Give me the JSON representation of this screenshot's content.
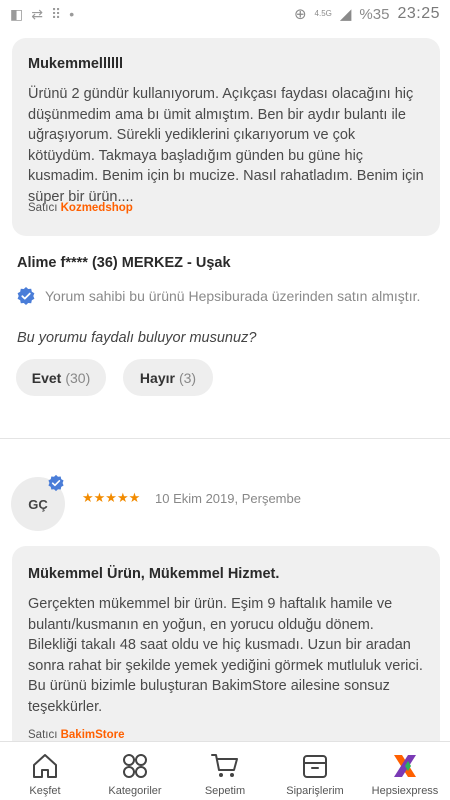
{
  "status_bar": {
    "time": "23:25",
    "battery": "%35",
    "network": "4.5G"
  },
  "review1": {
    "title": "Mukemmellllll",
    "body": "Ürünü 2 gündür kullanıyorum. Açıkçası faydası olacağını hiç düşünmedim ama bı ümit almıştım. Ben bir aydır bulantı ile uğraşıyorum. Sürekli yediklerini çıkarıyorum ve çok kötüydüm. Takmaya başladığım günden bu güne hiç kusmadim. Benim için bı mucize. Nasıl rahatladım. Benim için süper bir ürün....",
    "seller_label": "Satıcı",
    "seller_name": "Kozmedshop",
    "reviewer": "Alime f**** (36) MERKEZ - Uşak",
    "verified_text": "Yorum sahibi bu ürünü Hepsiburada üzerinden satın almıştır.",
    "helpful_question": "Bu yorumu faydalı buluyor musunuz?",
    "yes_label": "Evet",
    "yes_count": "(30)",
    "no_label": "Hayır",
    "no_count": "(3)"
  },
  "review2": {
    "avatar_initials": "GÇ",
    "rating": 5,
    "stars": "★★★★★",
    "date": "10 Ekim 2019, Perşembe",
    "title": "Mükemmel Ürün, Mükemmel Hizmet.",
    "body": "Gerçekten mükemmel bir ürün. Eşim 9 haftalık hamile ve bulantı/kusmanın en yoğun, en yorucu olduğu dönem. Bilekliği takalı 48 saat oldu ve hiç kusmadı. Uzun bir aradan sonra rahat bir şekilde yemek yediğini görmek mutluluk verici. Bu ürünü bizimle buluşturan BakimStore ailesine sonsuz teşekkürler.",
    "seller_label": "Satıcı",
    "seller_name": "BakimStore"
  },
  "nav": [
    {
      "label": "Keşfet",
      "icon": "home-icon"
    },
    {
      "label": "Kategoriler",
      "icon": "grid-icon"
    },
    {
      "label": "Sepetim",
      "icon": "cart-icon"
    },
    {
      "label": "Siparişlerim",
      "icon": "box-icon"
    },
    {
      "label": "Hepsiexpress",
      "icon": "hepsiexpress-logo"
    }
  ],
  "colors": {
    "accent": "#ff6000",
    "verified_blue": "#4a7dd8",
    "star": "#f28b00"
  }
}
